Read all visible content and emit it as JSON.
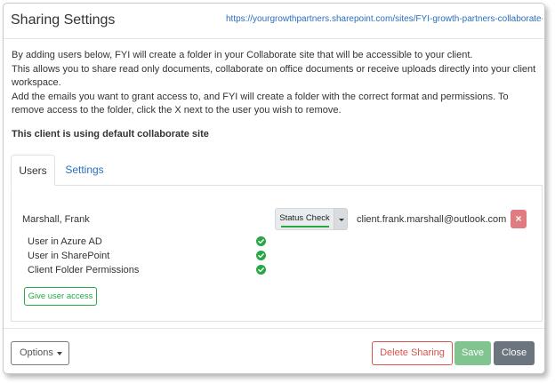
{
  "dialog": {
    "title": "Sharing Settings",
    "url": "https://yourgrowthpartners.sharepoint.com/sites/FYI-growth-partners-collaborate-...",
    "paragraphs": [
      "By adding users below, FYI will create a folder in your Collaborate site that will be accessible to your client.",
      "This allows you to share read only documents, collaborate on office documents or receive uploads directly into your client workspace.",
      "Add the emails you want to grant access to, and FYI will create a folder with the correct format and permissions. To remove access to the folder, click the X next to the user you wish to remove."
    ],
    "default_site_note": "This client is using default collaborate site"
  },
  "tabs": [
    {
      "label": "Users",
      "active": true
    },
    {
      "label": "Settings",
      "active": false
    }
  ],
  "user": {
    "name": "Marshall, Frank",
    "status_button": "Status Check",
    "email": "client.frank.marshall@outlook.com",
    "remove_label": "×",
    "checks": [
      {
        "label": "User in Azure AD",
        "ok": true
      },
      {
        "label": "User in SharePoint",
        "ok": true
      },
      {
        "label": "Client Folder Permissions",
        "ok": true
      }
    ],
    "give_access_label": "Give user access"
  },
  "footer": {
    "options_label": "Options",
    "delete_label": "Delete Sharing",
    "save_label": "Save",
    "close_label": "Close"
  },
  "colors": {
    "link": "#2a6fbd",
    "success": "#28a745",
    "danger": "#d9534f",
    "save_disabled": "#82c48f",
    "close": "#6c757d",
    "remove": "#e07b82"
  },
  "icons": {
    "check": "check-circle-icon",
    "caret": "caret-down-icon",
    "remove": "close-icon"
  }
}
